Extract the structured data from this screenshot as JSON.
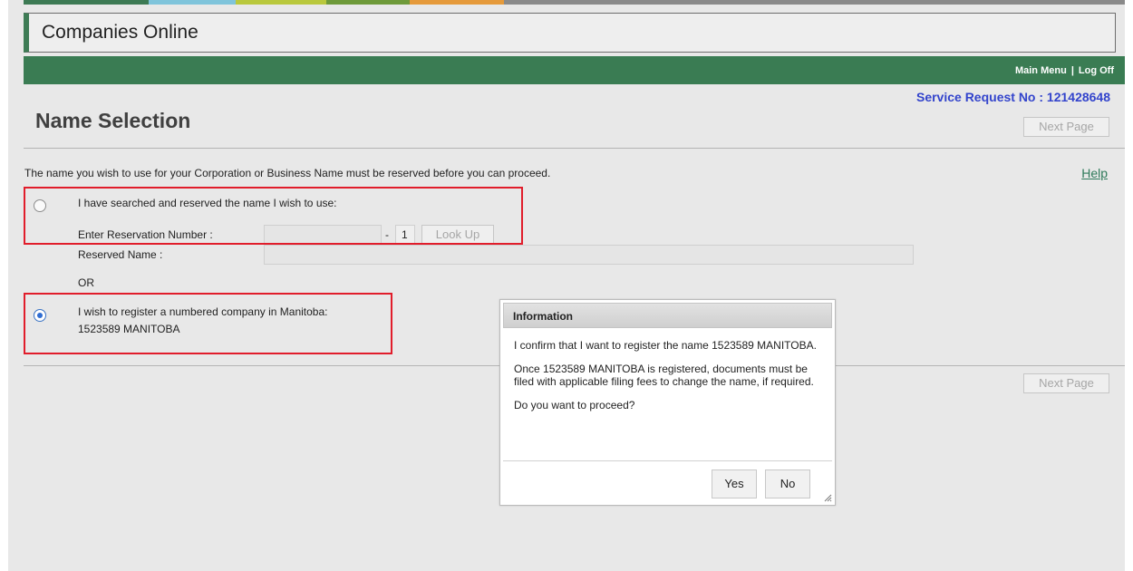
{
  "colors": {
    "strip": [
      "#3d7a54",
      "#7fc4db",
      "#b9c83d",
      "#6e9a3a",
      "#e59a3b",
      "#8a8a8a"
    ],
    "brand_green": "#3a7c53",
    "service_request_color": "#3344cc",
    "highlight_red": "#e11d2b",
    "help_color": "#2e7a5a"
  },
  "header": {
    "app_title": "Companies Online",
    "links": {
      "main_menu": "Main Menu",
      "separator": "|",
      "log_off": "Log Off"
    }
  },
  "service_request": "Service Request No : 121428648",
  "page": {
    "title": "Name Selection",
    "next_page_label": "Next Page",
    "intro": "The name you wish to use for your Corporation or Business Name must be reserved before you can proceed.",
    "help": "Help"
  },
  "option_reserved": {
    "label": "I have searched and reserved the name I wish to use:",
    "reservation_label": "Enter Reservation Number :",
    "reservation_value": "",
    "dash": "-",
    "suffix": "1",
    "lookup_label": "Look Up",
    "reserved_name_label": "Reserved Name :",
    "reserved_name_value": "",
    "selected": false
  },
  "or_label": "OR",
  "option_numbered": {
    "label": "I wish to register a numbered company in Manitoba:",
    "company_name": "1523589 MANITOBA",
    "selected": true
  },
  "dialog": {
    "title": "Information",
    "paragraphs": [
      "I confirm that I want to register the name 1523589 MANITOBA.",
      "Once 1523589 MANITOBA is registered, documents must be filed with applicable filing fees to change the name, if required.",
      "Do you want to proceed?"
    ],
    "yes_label": "Yes",
    "no_label": "No"
  }
}
